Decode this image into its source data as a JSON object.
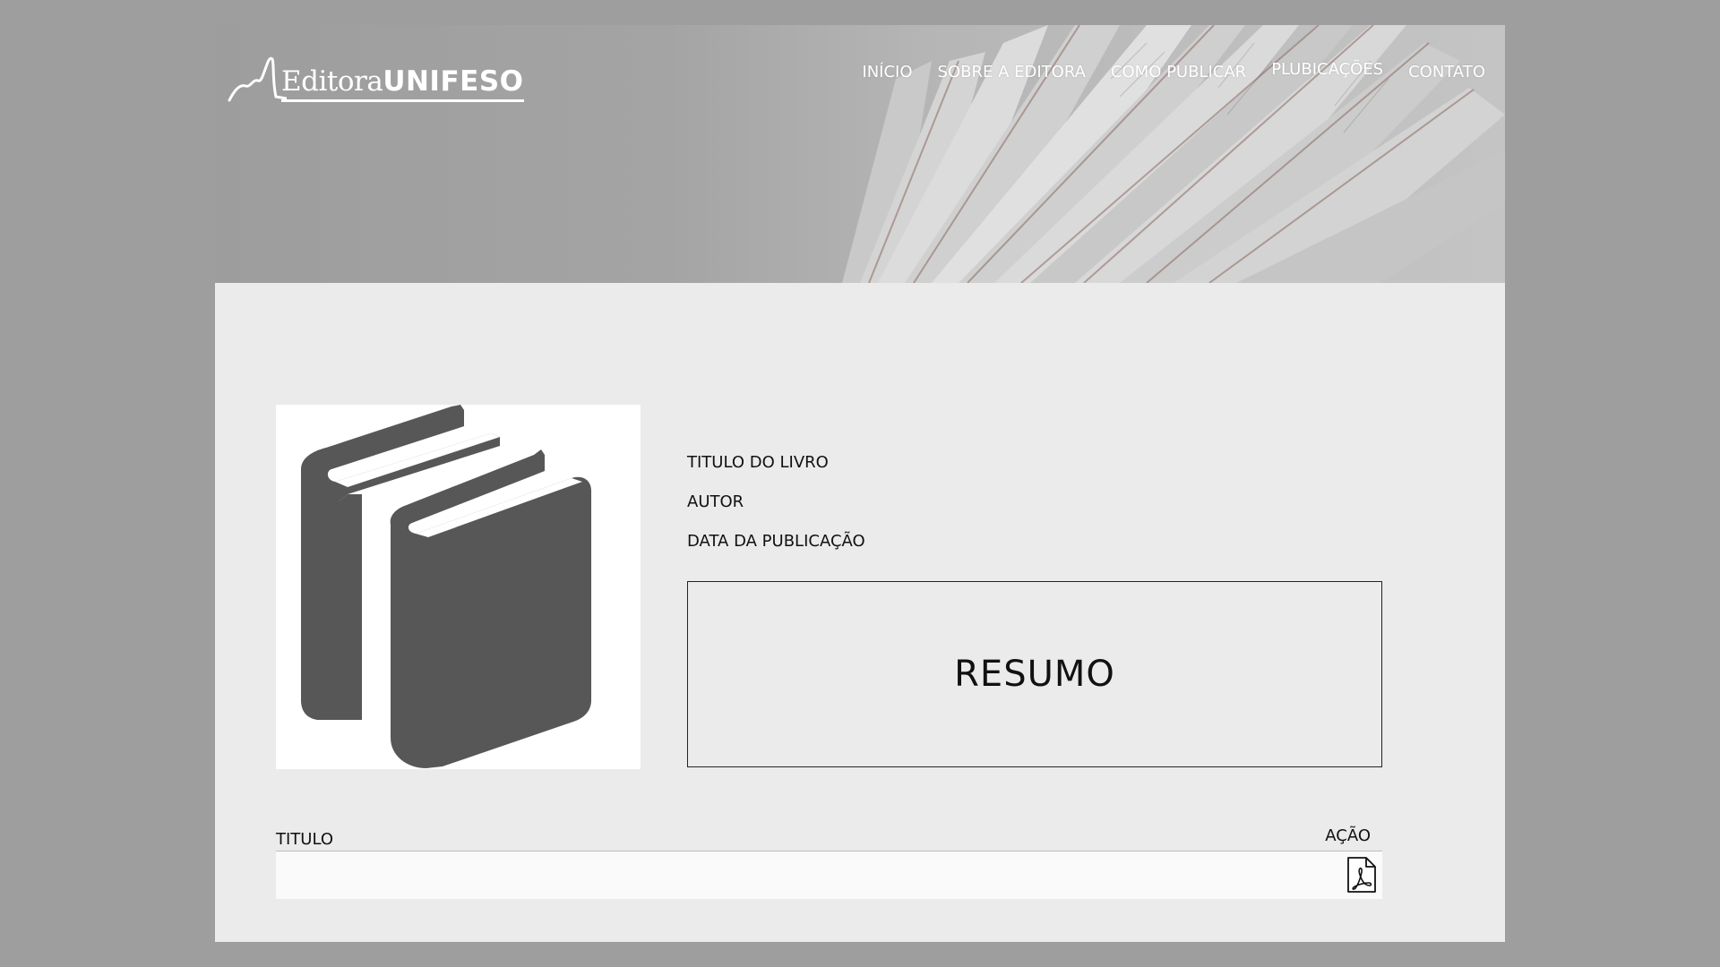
{
  "header": {
    "logo": {
      "text_light": "Editora",
      "text_bold": "UNIFESO"
    },
    "nav": [
      {
        "label": "INÍCIO"
      },
      {
        "label": "SOBRE A EDITORA"
      },
      {
        "label": "COMO PUBLICAR"
      },
      {
        "label": "PLUBICAÇÕES"
      },
      {
        "label": "CONTATO"
      }
    ]
  },
  "book": {
    "cover_icon": "books-icon",
    "title_label": "TITULO DO LIVRO",
    "author_label": "AUTOR",
    "date_label": "DATA DA PUBLICAÇÃO",
    "summary_label": "RESUMO"
  },
  "table": {
    "columns": {
      "title": "TITULO",
      "action": "AÇÃO"
    },
    "rows": [
      {
        "title": "",
        "action_icon": "pdf-icon"
      }
    ]
  },
  "colors": {
    "background": "#9e9e9e",
    "page": "#ebebeb",
    "icon_gray": "#575757"
  }
}
